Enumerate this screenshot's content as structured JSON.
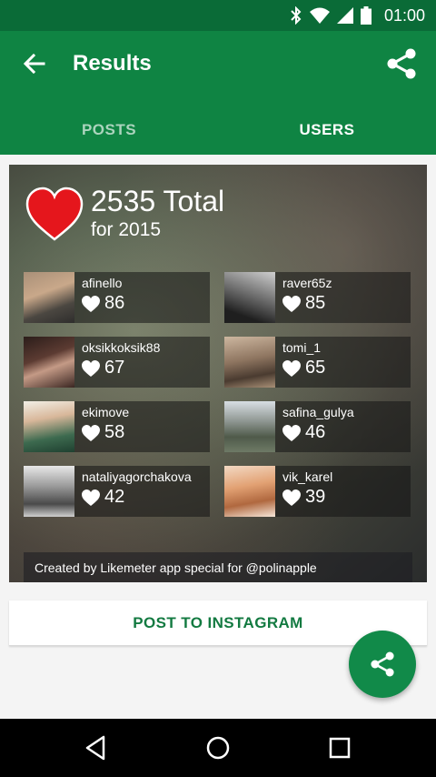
{
  "status_bar": {
    "time": "01:00",
    "icons": [
      "bluetooth-icon",
      "wifi-icon",
      "signal-icon",
      "battery-icon"
    ],
    "color": "#0a6b37"
  },
  "app_bar": {
    "title": "Results",
    "color": "#0f8443",
    "tabs": [
      {
        "label": "POSTS",
        "active": false
      },
      {
        "label": "USERS",
        "active": true
      }
    ]
  },
  "card": {
    "total": "2535 Total",
    "period": "for 2015",
    "heart_color": "#e5161c",
    "users": [
      {
        "name": "afinello",
        "likes": "86"
      },
      {
        "name": "raver65z",
        "likes": "85"
      },
      {
        "name": "oksikkoksik88",
        "likes": "67"
      },
      {
        "name": "tomi_1",
        "likes": "65"
      },
      {
        "name": "ekimove",
        "likes": "58"
      },
      {
        "name": "safina_gulya",
        "likes": "46"
      },
      {
        "name": "nataliyagorchakova",
        "likes": "42"
      },
      {
        "name": "vik_karel",
        "likes": "39"
      }
    ],
    "footer": "Created by Likemeter app special for @polinapple"
  },
  "actions": {
    "post_label": "POST TO INSTAGRAM",
    "accent": "#137a41"
  }
}
